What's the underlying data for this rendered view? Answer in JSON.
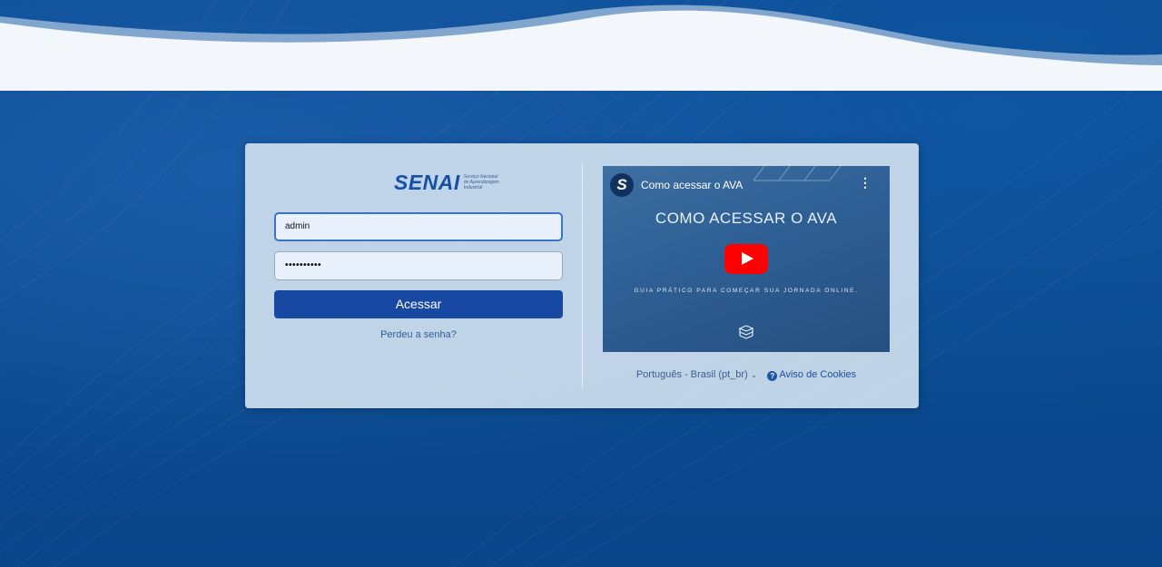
{
  "brand": {
    "name": "SENAI",
    "subtitle": "Serviço Nacional de Aprendizagem Industrial"
  },
  "login": {
    "username_value": "admin",
    "password_mask": "••••••••••",
    "submit_label": "Acessar",
    "forgot_label": "Perdeu a senha?"
  },
  "video": {
    "channel_initial": "S",
    "title": "Como acessar o AVA",
    "headline": "COMO ACESSAR O AVA",
    "subtitle": "GUIA PRÁTICO PARA COMEÇAR SUA JORNADA ONLINE.",
    "menu_icon": "kebab-icon",
    "play_icon": "play-icon"
  },
  "footer": {
    "language": "Português - Brasil (pt_br)",
    "cookies": "Aviso de Cookies",
    "help_glyph": "?"
  },
  "colors": {
    "background": "#0c4a92",
    "primary_button": "#1749a3",
    "play_button": "#ff0000"
  }
}
